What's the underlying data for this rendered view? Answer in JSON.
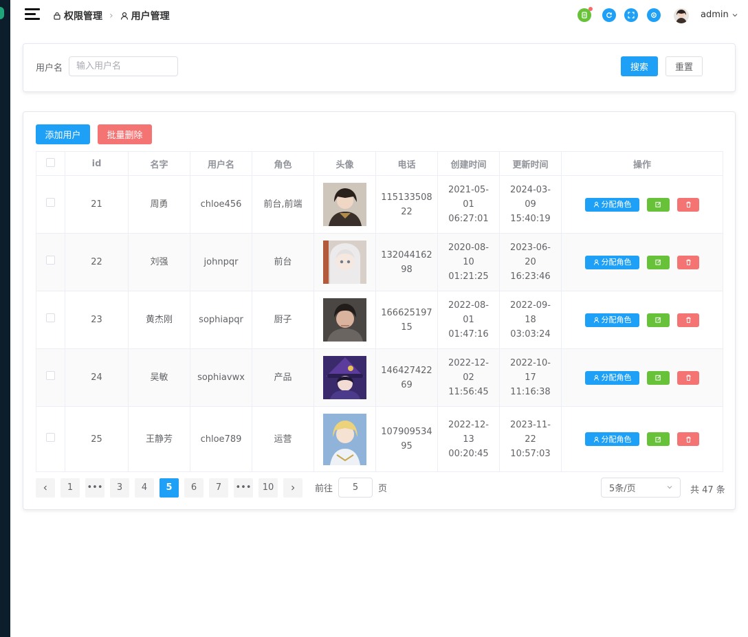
{
  "breadcrumb": {
    "parent": "权限管理",
    "current": "用户管理"
  },
  "header": {
    "username": "admin"
  },
  "search": {
    "label": "用户名",
    "placeholder": "输入用户名",
    "value": "",
    "search_btn": "搜索",
    "reset_btn": "重置"
  },
  "actions": {
    "add_btn": "添加用户",
    "batch_delete_btn": "批量删除"
  },
  "table": {
    "headers": {
      "id": "id",
      "name": "名字",
      "username": "用户名",
      "role": "角色",
      "avatar": "头像",
      "phone": "电话",
      "created": "创建时间",
      "updated": "更新时间",
      "ops": "操作"
    },
    "op_assign_label": "分配角色",
    "rows": [
      {
        "id": "21",
        "name": "周勇",
        "username": "chloe456",
        "role": "前台,前端",
        "phone_l1": "115133508",
        "phone_l2": "22",
        "created_d1": "2021-05-",
        "created_d2": "01",
        "created_t": "06:27:01",
        "updated_d1": "2024-03-",
        "updated_d2": "09",
        "updated_t": "15:40:19"
      },
      {
        "id": "22",
        "name": "刘强",
        "username": "johnpqr",
        "role": "前台",
        "phone_l1": "132044162",
        "phone_l2": "98",
        "created_d1": "2020-08-",
        "created_d2": "10",
        "created_t": "01:21:25",
        "updated_d1": "2023-06-",
        "updated_d2": "20",
        "updated_t": "16:23:46"
      },
      {
        "id": "23",
        "name": "黄杰刚",
        "username": "sophiapqr",
        "role": "厨子",
        "phone_l1": "166625197",
        "phone_l2": "15",
        "created_d1": "2022-08-",
        "created_d2": "01",
        "created_t": "01:47:16",
        "updated_d1": "2022-09-",
        "updated_d2": "18",
        "updated_t": "03:03:24"
      },
      {
        "id": "24",
        "name": "吴敏",
        "username": "sophiavwx",
        "role": "产品",
        "phone_l1": "146427422",
        "phone_l2": "69",
        "created_d1": "2022-12-",
        "created_d2": "02",
        "created_t": "11:56:45",
        "updated_d1": "2022-10-",
        "updated_d2": "17",
        "updated_t": "11:16:38"
      },
      {
        "id": "25",
        "name": "王静芳",
        "username": "chloe789",
        "role": "运营",
        "phone_l1": "107909534",
        "phone_l2": "95",
        "created_d1": "2022-12-",
        "created_d2": "13",
        "created_t": "00:20:45",
        "updated_d1": "2023-11-",
        "updated_d2": "22",
        "updated_t": "10:57:03"
      }
    ]
  },
  "pagination": {
    "prev_icon": "chevron-left-icon",
    "next_icon": "chevron-right-icon",
    "pages": [
      "1",
      "•••",
      "3",
      "4",
      "5",
      "6",
      "7",
      "•••",
      "10"
    ],
    "current": "5",
    "goto_label": "前往",
    "goto_value": "5",
    "goto_suffix": "页",
    "page_size": "5条/页",
    "total": "共 47 条"
  },
  "colors": {
    "primary": "#1ea0f6",
    "success": "#67c23a",
    "danger": "#f47474",
    "sidebar": "#0c1e2b"
  }
}
